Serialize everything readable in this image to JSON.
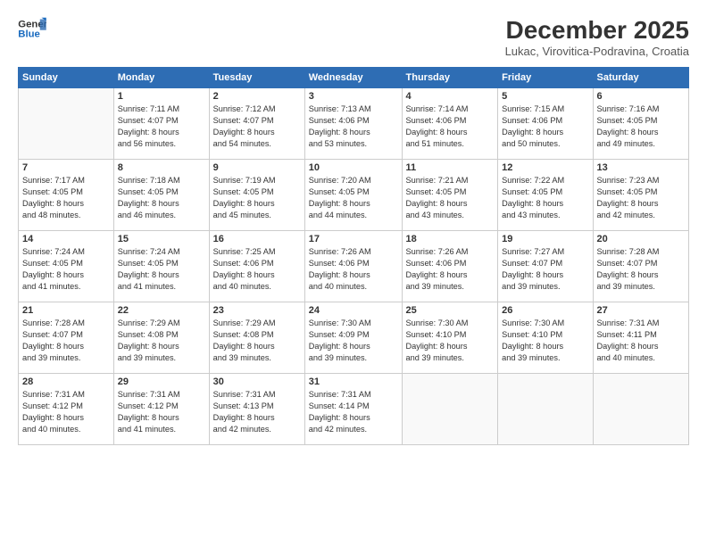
{
  "header": {
    "logo_line1": "General",
    "logo_line2": "Blue",
    "month_title": "December 2025",
    "location": "Lukac, Virovitica-Podravina, Croatia"
  },
  "weekdays": [
    "Sunday",
    "Monday",
    "Tuesday",
    "Wednesday",
    "Thursday",
    "Friday",
    "Saturday"
  ],
  "weeks": [
    [
      {
        "day": "",
        "info": ""
      },
      {
        "day": "1",
        "info": "Sunrise: 7:11 AM\nSunset: 4:07 PM\nDaylight: 8 hours\nand 56 minutes."
      },
      {
        "day": "2",
        "info": "Sunrise: 7:12 AM\nSunset: 4:07 PM\nDaylight: 8 hours\nand 54 minutes."
      },
      {
        "day": "3",
        "info": "Sunrise: 7:13 AM\nSunset: 4:06 PM\nDaylight: 8 hours\nand 53 minutes."
      },
      {
        "day": "4",
        "info": "Sunrise: 7:14 AM\nSunset: 4:06 PM\nDaylight: 8 hours\nand 51 minutes."
      },
      {
        "day": "5",
        "info": "Sunrise: 7:15 AM\nSunset: 4:06 PM\nDaylight: 8 hours\nand 50 minutes."
      },
      {
        "day": "6",
        "info": "Sunrise: 7:16 AM\nSunset: 4:05 PM\nDaylight: 8 hours\nand 49 minutes."
      }
    ],
    [
      {
        "day": "7",
        "info": "Sunrise: 7:17 AM\nSunset: 4:05 PM\nDaylight: 8 hours\nand 48 minutes."
      },
      {
        "day": "8",
        "info": "Sunrise: 7:18 AM\nSunset: 4:05 PM\nDaylight: 8 hours\nand 46 minutes."
      },
      {
        "day": "9",
        "info": "Sunrise: 7:19 AM\nSunset: 4:05 PM\nDaylight: 8 hours\nand 45 minutes."
      },
      {
        "day": "10",
        "info": "Sunrise: 7:20 AM\nSunset: 4:05 PM\nDaylight: 8 hours\nand 44 minutes."
      },
      {
        "day": "11",
        "info": "Sunrise: 7:21 AM\nSunset: 4:05 PM\nDaylight: 8 hours\nand 43 minutes."
      },
      {
        "day": "12",
        "info": "Sunrise: 7:22 AM\nSunset: 4:05 PM\nDaylight: 8 hours\nand 43 minutes."
      },
      {
        "day": "13",
        "info": "Sunrise: 7:23 AM\nSunset: 4:05 PM\nDaylight: 8 hours\nand 42 minutes."
      }
    ],
    [
      {
        "day": "14",
        "info": "Sunrise: 7:24 AM\nSunset: 4:05 PM\nDaylight: 8 hours\nand 41 minutes."
      },
      {
        "day": "15",
        "info": "Sunrise: 7:24 AM\nSunset: 4:05 PM\nDaylight: 8 hours\nand 41 minutes."
      },
      {
        "day": "16",
        "info": "Sunrise: 7:25 AM\nSunset: 4:06 PM\nDaylight: 8 hours\nand 40 minutes."
      },
      {
        "day": "17",
        "info": "Sunrise: 7:26 AM\nSunset: 4:06 PM\nDaylight: 8 hours\nand 40 minutes."
      },
      {
        "day": "18",
        "info": "Sunrise: 7:26 AM\nSunset: 4:06 PM\nDaylight: 8 hours\nand 39 minutes."
      },
      {
        "day": "19",
        "info": "Sunrise: 7:27 AM\nSunset: 4:07 PM\nDaylight: 8 hours\nand 39 minutes."
      },
      {
        "day": "20",
        "info": "Sunrise: 7:28 AM\nSunset: 4:07 PM\nDaylight: 8 hours\nand 39 minutes."
      }
    ],
    [
      {
        "day": "21",
        "info": "Sunrise: 7:28 AM\nSunset: 4:07 PM\nDaylight: 8 hours\nand 39 minutes."
      },
      {
        "day": "22",
        "info": "Sunrise: 7:29 AM\nSunset: 4:08 PM\nDaylight: 8 hours\nand 39 minutes."
      },
      {
        "day": "23",
        "info": "Sunrise: 7:29 AM\nSunset: 4:08 PM\nDaylight: 8 hours\nand 39 minutes."
      },
      {
        "day": "24",
        "info": "Sunrise: 7:30 AM\nSunset: 4:09 PM\nDaylight: 8 hours\nand 39 minutes."
      },
      {
        "day": "25",
        "info": "Sunrise: 7:30 AM\nSunset: 4:10 PM\nDaylight: 8 hours\nand 39 minutes."
      },
      {
        "day": "26",
        "info": "Sunrise: 7:30 AM\nSunset: 4:10 PM\nDaylight: 8 hours\nand 39 minutes."
      },
      {
        "day": "27",
        "info": "Sunrise: 7:31 AM\nSunset: 4:11 PM\nDaylight: 8 hours\nand 40 minutes."
      }
    ],
    [
      {
        "day": "28",
        "info": "Sunrise: 7:31 AM\nSunset: 4:12 PM\nDaylight: 8 hours\nand 40 minutes."
      },
      {
        "day": "29",
        "info": "Sunrise: 7:31 AM\nSunset: 4:12 PM\nDaylight: 8 hours\nand 41 minutes."
      },
      {
        "day": "30",
        "info": "Sunrise: 7:31 AM\nSunset: 4:13 PM\nDaylight: 8 hours\nand 42 minutes."
      },
      {
        "day": "31",
        "info": "Sunrise: 7:31 AM\nSunset: 4:14 PM\nDaylight: 8 hours\nand 42 minutes."
      },
      {
        "day": "",
        "info": ""
      },
      {
        "day": "",
        "info": ""
      },
      {
        "day": "",
        "info": ""
      }
    ]
  ]
}
